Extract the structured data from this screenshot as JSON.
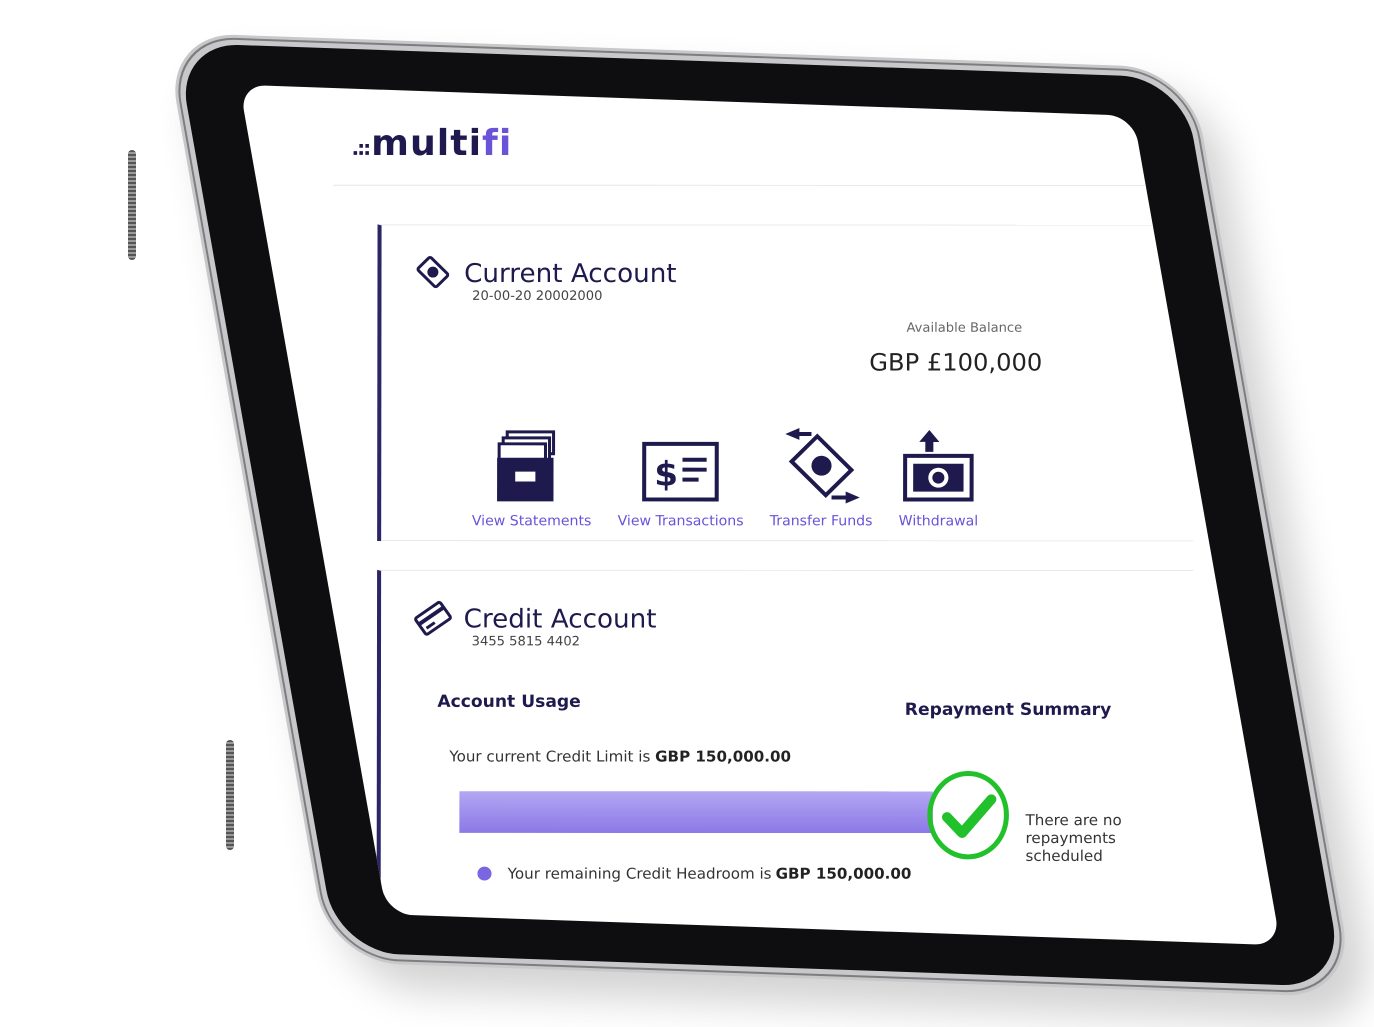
{
  "brand": {
    "logo_main": "multi",
    "logo_accent": "fi",
    "logo_dots": ".::",
    "primary_color": "#1f1a4d",
    "accent_color": "#6a52d9"
  },
  "current_account": {
    "title": "Current Account",
    "account_number": "20-00-20 20002000",
    "balance_label": "Available Balance",
    "balance_value": "GBP £100,000",
    "actions": [
      {
        "label": "View Statements",
        "icon": "statements-icon"
      },
      {
        "label": "View Transactions",
        "icon": "transactions-icon"
      },
      {
        "label": "Transfer Funds",
        "icon": "transfer-icon"
      },
      {
        "label": "Withdrawal",
        "icon": "withdrawal-icon"
      }
    ]
  },
  "credit_account": {
    "title": "Credit Account",
    "account_number": "3455 5815 4402",
    "usage_title": "Account Usage",
    "limit_prefix": "Your current Credit Limit is",
    "limit_value": "GBP 150,000.00",
    "headroom_prefix": "Your remaining Credit Headroom is",
    "headroom_value": "GBP 150,000.00",
    "usage_fill_fraction": 1.0,
    "repayment_title": "Repayment Summary",
    "repayment_text": "There are no repayments scheduled",
    "status_color": "#22c02a"
  }
}
